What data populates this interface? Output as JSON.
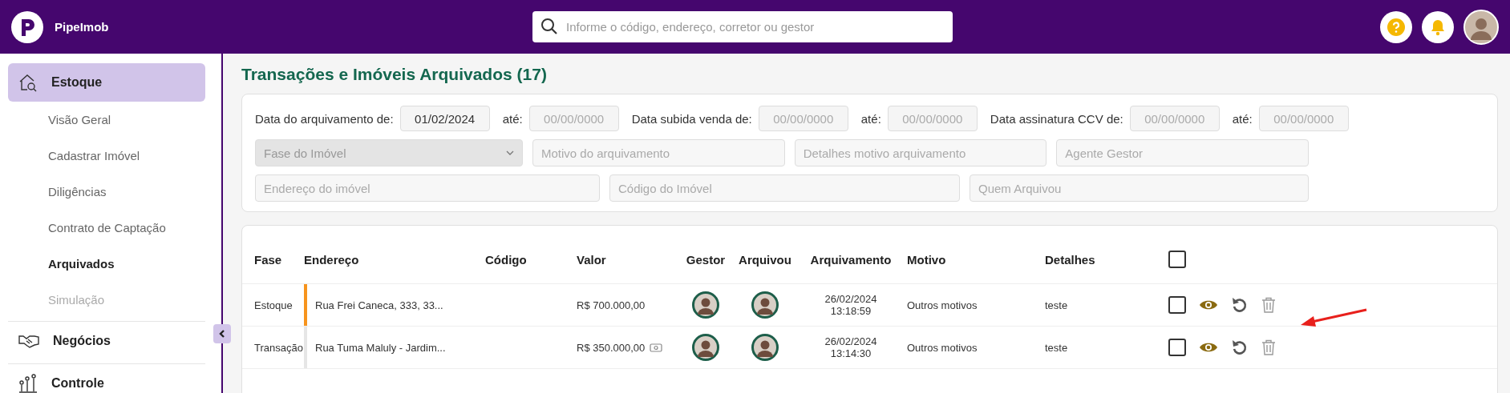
{
  "header": {
    "app_name": "PipeImob",
    "search": {
      "placeholder": "Informe o código, endereço, corretor ou gestor"
    }
  },
  "sidebar": {
    "items": [
      {
        "label": "Estoque",
        "selected": true,
        "children": [
          {
            "label": "Visão Geral",
            "selected": false,
            "disabled": false
          },
          {
            "label": "Cadastrar Imóvel",
            "selected": false,
            "disabled": false
          },
          {
            "label": "Diligências",
            "selected": false,
            "disabled": false
          },
          {
            "label": "Contrato de Captação",
            "selected": false,
            "disabled": false
          },
          {
            "label": "Arquivados",
            "selected": true,
            "disabled": false
          },
          {
            "label": "Simulação",
            "selected": false,
            "disabled": true
          }
        ]
      },
      {
        "label": "Negócios",
        "selected": false
      },
      {
        "label": "Controle",
        "selected": false
      }
    ]
  },
  "page": {
    "title": "Transações e Imóveis Arquivados (17)"
  },
  "filters": {
    "date_ranges": [
      {
        "label": "Data do arquivamento de:",
        "from": "01/02/2024",
        "to_label": "até:",
        "to_placeholder": "00/00/0000"
      },
      {
        "label": "Data subida venda de:",
        "from_placeholder": "00/00/0000",
        "to_label": "até:",
        "to_placeholder": "00/00/0000"
      },
      {
        "label": "Data assinatura CCV de:",
        "from_placeholder": "00/00/0000",
        "to_label": "até:",
        "to_placeholder": "00/00/0000"
      }
    ],
    "row_2": [
      {
        "kind": "select",
        "placeholder": "Fase do Imóvel",
        "disabled": true
      },
      {
        "kind": "text",
        "placeholder": "Motivo do arquivamento"
      },
      {
        "kind": "text",
        "placeholder": "Detalhes motivo arquivamento"
      },
      {
        "kind": "text",
        "placeholder": "Agente Gestor"
      }
    ],
    "row_3": [
      {
        "kind": "text",
        "placeholder": "Endereço do imóvel"
      },
      {
        "kind": "text",
        "placeholder": "Código do Imóvel"
      },
      {
        "kind": "text",
        "placeholder": "Quem Arquivou"
      }
    ]
  },
  "table": {
    "columns": [
      "Fase",
      "Endereço",
      "Código",
      "Valor",
      "Gestor",
      "Arquivou",
      "Arquivamento",
      "Motivo",
      "Detalhes"
    ],
    "select_all_checked": false,
    "rows": [
      {
        "fase": "Estoque",
        "color": "#f7941d",
        "endereco": "Rua Frei Caneca, 333, 33...",
        "valor": "R$ 700.000,00",
        "cash_icon": false,
        "data": "26/02/2024",
        "hora": "13:18:59",
        "motivo": "Outros motivos",
        "detalhes": "teste",
        "checked": false
      },
      {
        "fase": "Transação",
        "color": "#e6e6e6",
        "endereco": "Rua Tuma Maluly - Jardim...",
        "valor": "R$ 350.000,00",
        "cash_icon": true,
        "data": "26/02/2024",
        "hora": "13:14:30",
        "motivo": "Outros motivos",
        "detalhes": "teste",
        "checked": false
      }
    ]
  }
}
